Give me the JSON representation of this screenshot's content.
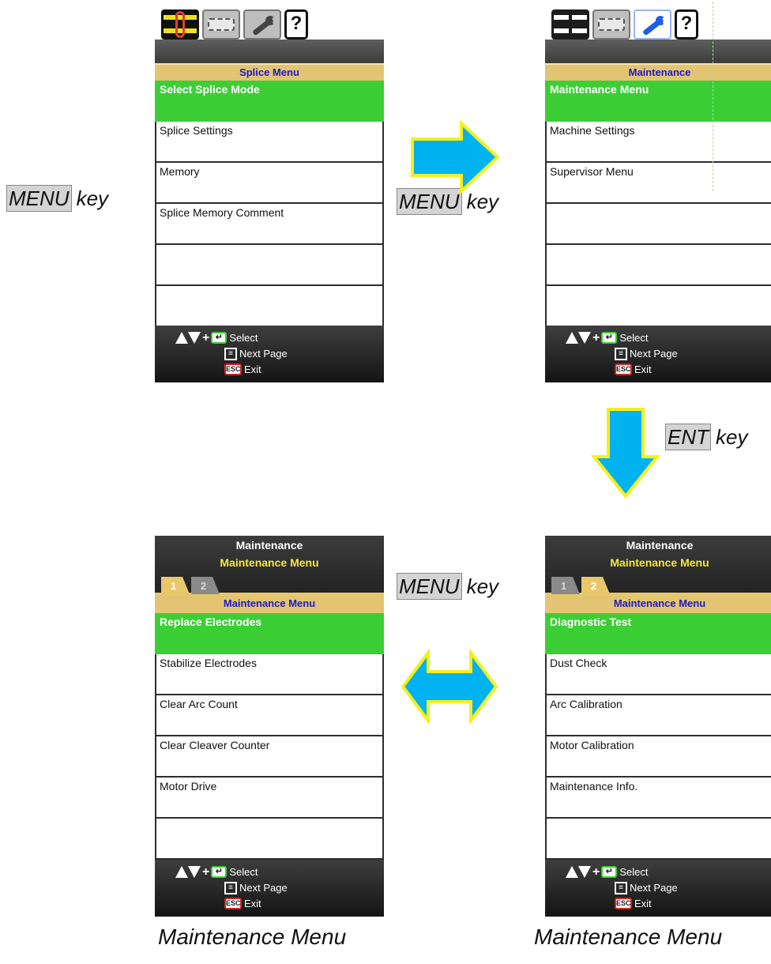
{
  "keys": {
    "menu_key": "MENU",
    "ent_key": "ENT",
    "key_word": "key"
  },
  "screen1": {
    "title": "Splice Menu",
    "rows": [
      "Select Splice Mode",
      "Splice Settings",
      "Memory",
      "Splice Memory Comment",
      "",
      ""
    ]
  },
  "screen2": {
    "title": "Maintenance",
    "rows": [
      "Maintenance Menu",
      "Machine Settings",
      "Supervisor Menu",
      "",
      "",
      ""
    ]
  },
  "screen3": {
    "header_line1": "Maintenance",
    "header_line2": "Maintenance Menu",
    "tabs": [
      "1",
      "2"
    ],
    "active_tab": "1",
    "section": "Maintenance Menu",
    "rows": [
      "Replace Electrodes",
      "Stabilize Electrodes",
      "Clear Arc Count",
      "Clear Cleaver Counter",
      "Motor Drive",
      ""
    ]
  },
  "screen4": {
    "header_line1": "Maintenance",
    "header_line2": "Maintenance Menu",
    "tabs": [
      "1",
      "2"
    ],
    "active_tab": "2",
    "section": "Maintenance Menu",
    "rows": [
      "Diagnostic Test",
      "Dust Check",
      "Arc Calibration",
      "Motor Calibration",
      "Maintenance Info.",
      ""
    ]
  },
  "footer": {
    "select": "Select",
    "next_page": "Next Page",
    "exit": "Exit",
    "enter_glyph": "↵",
    "page_glyph": "≡",
    "esc_glyph": "ESC"
  },
  "tab_icons": [
    "splice-icon",
    "heater-icon",
    "wrench-icon",
    "help-icon"
  ],
  "help_glyph": "?",
  "captions": {
    "left": "Maintenance Menu",
    "right": "Maintenance Menu"
  },
  "colors": {
    "selected_row": "#3ccf35",
    "section_header": "#e2c472",
    "arrow_fill": "#00b2f0",
    "arrow_outline": "#f5ef20"
  }
}
